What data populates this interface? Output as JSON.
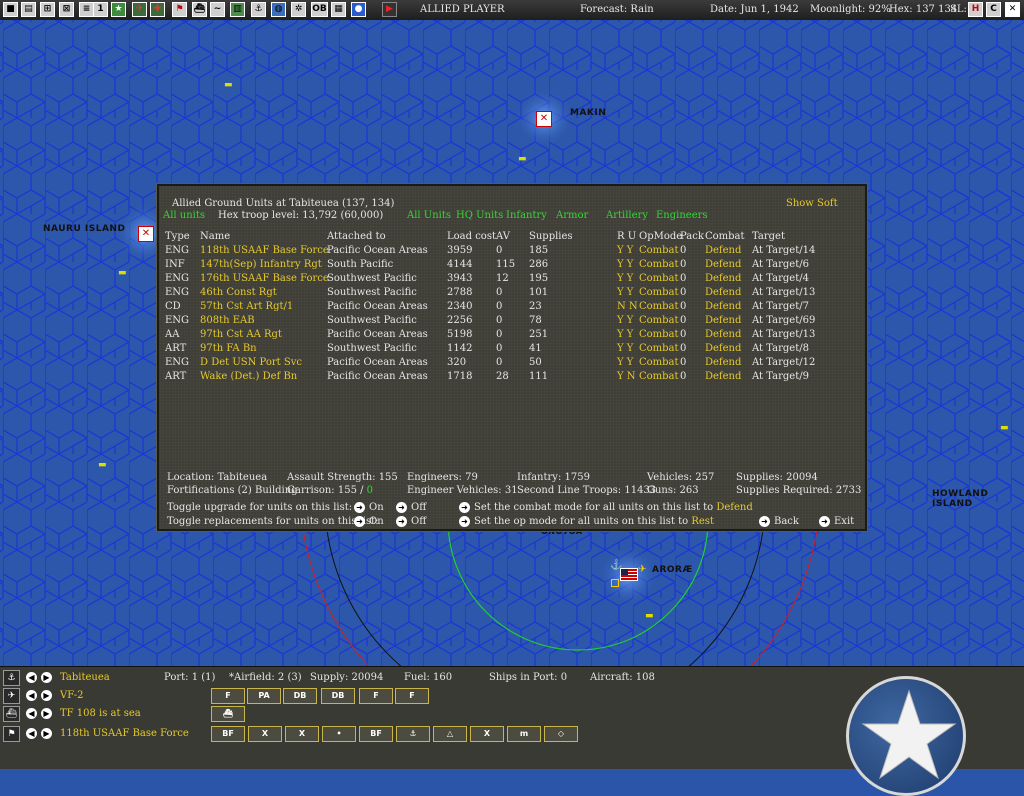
{
  "topbar": {
    "buttons": [
      "home",
      "doc",
      "report",
      "ground",
      "info",
      "rank",
      "air",
      "medic",
      "flag",
      "ship",
      "sub",
      "base",
      "hq",
      "globe",
      "ops",
      "OB",
      "map",
      "turn",
      "end"
    ],
    "player": "ALLIED PLAYER",
    "forecast": "Forecast: Rain",
    "date": "Date: Jun 1, 1942",
    "moonlight": "Moonlight: 92%",
    "hex": "Hex: 137 134",
    "sl": "SL:",
    "sys": [
      "H",
      "C"
    ]
  },
  "map": {
    "labels": [
      "MAKIN",
      "NAURU ISLAND",
      "HOWLAND ISLAND",
      "ARORÆ",
      "ONOTOA"
    ]
  },
  "panel": {
    "title": "Allied Ground Units at Tabiteuea  (137, 134)",
    "all_units_left": "All units",
    "troop_level": "Hex troop level: 13,792  (60,000)",
    "show_soft": "Show Soft",
    "filters": [
      "All Units",
      "HQ Units",
      "Infantry",
      "Armor",
      "Artillery",
      "Engineers"
    ],
    "headers": {
      "type": "Type",
      "name": "Name",
      "attached": "Attached to",
      "load": "Load cost",
      "av": "AV",
      "supplies": "Supplies",
      "ru": "R  U",
      "opmode": "OpMode",
      "pack": "Pack",
      "combat": "Combat",
      "target": "Target"
    },
    "units": [
      {
        "type": "ENG",
        "name": "118th USAAF Base Force",
        "attached": "Pacific Ocean Areas",
        "load": "3959",
        "av": "0",
        "supplies": "185",
        "ru": "Y  Y",
        "opmode": "Combat",
        "pack": "0",
        "combat": "Defend",
        "target": "At Target/14"
      },
      {
        "type": "INF",
        "name": "147th(Sep) Infantry Rgt",
        "attached": "South Pacific",
        "load": "4144",
        "av": "115",
        "supplies": "286",
        "ru": "Y  Y",
        "opmode": "Combat",
        "pack": "0",
        "combat": "Defend",
        "target": "At Target/6"
      },
      {
        "type": "ENG",
        "name": "176th USAAF Base Force",
        "attached": "Southwest Pacific",
        "load": "3943",
        "av": "12",
        "supplies": "195",
        "ru": "Y  Y",
        "opmode": "Combat",
        "pack": "0",
        "combat": "Defend",
        "target": "At Target/4"
      },
      {
        "type": "ENG",
        "name": "46th Const Rgt",
        "attached": "Southwest Pacific",
        "load": "2788",
        "av": "0",
        "supplies": "101",
        "ru": "Y  Y",
        "opmode": "Combat",
        "pack": "0",
        "combat": "Defend",
        "target": "At Target/13"
      },
      {
        "type": "CD",
        "name": "57th Cst Art Rgt/1",
        "attached": "Pacific Ocean Areas",
        "load": "2340",
        "av": "0",
        "supplies": "23",
        "ru": "N  N",
        "opmode": "Combat",
        "pack": "0",
        "combat": "Defend",
        "target": "At Target/7"
      },
      {
        "type": "ENG",
        "name": "808th EAB",
        "attached": "Southwest Pacific",
        "load": "2256",
        "av": "0",
        "supplies": "78",
        "ru": "Y  Y",
        "opmode": "Combat",
        "pack": "0",
        "combat": "Defend",
        "target": "At Target/69"
      },
      {
        "type": "AA",
        "name": "97th Cst AA Rgt",
        "attached": "Pacific Ocean Areas",
        "load": "5198",
        "av": "0",
        "supplies": "251",
        "ru": "Y  Y",
        "opmode": "Combat",
        "pack": "0",
        "combat": "Defend",
        "target": "At Target/13"
      },
      {
        "type": "ART",
        "name": "97th FA Bn",
        "attached": "Southwest Pacific",
        "load": "1142",
        "av": "0",
        "supplies": "41",
        "ru": "Y  Y",
        "opmode": "Combat",
        "pack": "0",
        "combat": "Defend",
        "target": "At Target/8"
      },
      {
        "type": "ENG",
        "name": "D Det USN Port Svc",
        "attached": "Pacific Ocean Areas",
        "load": "320",
        "av": "0",
        "supplies": "50",
        "ru": "Y  Y",
        "opmode": "Combat",
        "pack": "0",
        "combat": "Defend",
        "target": "At Target/12"
      },
      {
        "type": "ART",
        "name": "Wake (Det.) Def Bn",
        "attached": "Pacific Ocean Areas",
        "load": "1718",
        "av": "28",
        "supplies": "111",
        "ru": "Y  N",
        "opmode": "Combat",
        "pack": "0",
        "combat": "Defend",
        "target": "At Target/9"
      }
    ],
    "summary": {
      "location": "Location: Tabiteuea",
      "fortifications": "Fortifications (2) Building",
      "assault": "Assault Strength: 155",
      "garrison": "Garrison:  155 / ",
      "garrison_val": "0",
      "engineers": "Engineers: 79",
      "eng_vehicles": "Engineer Vehicles:  31",
      "infantry": "Infantry: 1759",
      "second_line": "Second Line Troops: 11433",
      "vehicles": "Vehicles: 257",
      "guns": "Guns: 263",
      "supplies": "Supplies: 20094",
      "supplies_req": "Supplies Required:  2733"
    },
    "toggles": {
      "upgrade": "Toggle upgrade for units on this list:",
      "replace": "Toggle replacements for units on this list:",
      "on": "On",
      "off": "Off",
      "combat_mode": "Set the combat mode for all units on this list to",
      "combat_val": "Defend",
      "op_mode": "Set the op mode for all units on this list to",
      "op_val": "Rest",
      "back": "Back",
      "exit": "Exit"
    }
  },
  "bottom": {
    "base": "Tabiteuea",
    "port": "Port: 1 (1)",
    "airfield": "*Airfield: 2 (3)",
    "supply": "Supply: 20094",
    "fuel": "Fuel: 160",
    "ships": "Ships in Port: 0",
    "aircraft": "Aircraft: 108",
    "air_unit": "VF-2",
    "tf": "TF 108 is at sea",
    "ground": "118th USAAF Base Force",
    "air_icons": [
      "F",
      "PA",
      "DB",
      "DB",
      "F",
      "F"
    ],
    "ground_icons": [
      "BF",
      "X",
      "X",
      "•",
      "BF",
      "⚓",
      "△",
      "X",
      "m",
      "◇"
    ]
  }
}
